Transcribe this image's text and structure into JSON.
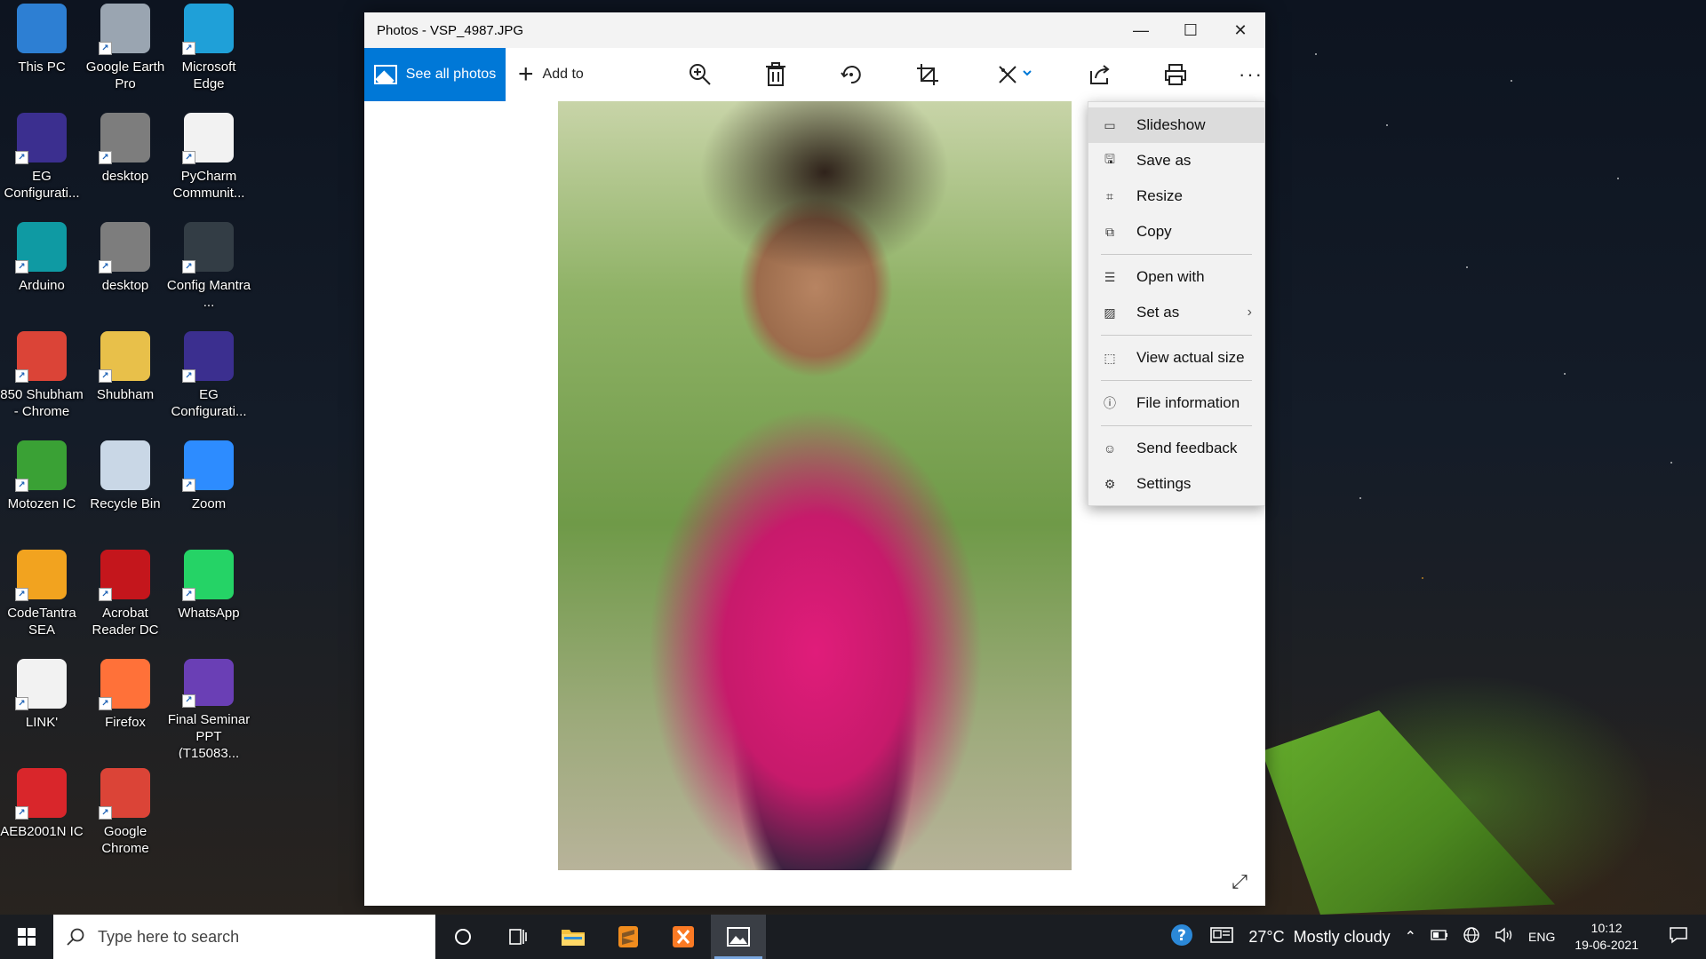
{
  "desktop": {
    "icons": [
      {
        "label": "This PC",
        "icon": "monitor-icon",
        "color": "#2d7fd3"
      },
      {
        "label": "Google Earth Pro",
        "icon": "globe-icon",
        "color": "#9aa5b1"
      },
      {
        "label": "Microsoft Edge",
        "icon": "edge-icon",
        "color": "#1fa0d8"
      },
      {
        "label": "EG Configurati...",
        "icon": "eg-icon",
        "color": "#3b2f8f"
      },
      {
        "label": "desktop",
        "icon": "settings-file-icon",
        "color": "#7d7d7d"
      },
      {
        "label": "PyCharm Communit...",
        "icon": "file-icon",
        "color": "#f2f2f2"
      },
      {
        "label": "Arduino",
        "icon": "arduino-icon",
        "color": "#0f9aa3"
      },
      {
        "label": "desktop",
        "icon": "settings-file-icon",
        "color": "#7d7d7d"
      },
      {
        "label": "Config Mantra ...",
        "icon": "config-icon",
        "color": "#333d45"
      },
      {
        "label": "850 Shubham - Chrome",
        "icon": "chrome-icon",
        "color": "#db4437"
      },
      {
        "label": "Shubham",
        "icon": "user-folder-icon",
        "color": "#e8c04a"
      },
      {
        "label": "EG Configurati...",
        "icon": "eg-icon",
        "color": "#3b2f8f"
      },
      {
        "label": "Motozen IC",
        "icon": "motozen-icon",
        "color": "#3aa135"
      },
      {
        "label": "Recycle Bin",
        "icon": "recycle-bin-icon",
        "color": "#c9d7e6"
      },
      {
        "label": "Zoom",
        "icon": "zoom-icon",
        "color": "#2d8cff"
      },
      {
        "label": "CodeTantra SEA",
        "icon": "sun-icon",
        "color": "#f2a31f"
      },
      {
        "label": "Acrobat Reader DC",
        "icon": "acrobat-icon",
        "color": "#c4161c"
      },
      {
        "label": "WhatsApp",
        "icon": "whatsapp-icon",
        "color": "#25d366"
      },
      {
        "label": "LINK'",
        "icon": "file-icon",
        "color": "#f2f2f2"
      },
      {
        "label": "Firefox",
        "icon": "firefox-icon",
        "color": "#ff7139"
      },
      {
        "label": "Final Seminar PPT (T15083...",
        "icon": "ppt-icon",
        "color": "#6a3fb5"
      },
      {
        "label": "AEB2001N IC",
        "icon": "aeb-icon",
        "color": "#d9262b"
      },
      {
        "label": "Google Chrome",
        "icon": "chrome-icon",
        "color": "#db4437"
      }
    ]
  },
  "window": {
    "title": "Photos - VSP_4987.JPG",
    "toolbar": {
      "see_all": "See all photos",
      "add_to": "Add to"
    }
  },
  "menu": {
    "items": [
      {
        "label": "Slideshow",
        "icon": "slideshow-icon",
        "glyph": "▭"
      },
      {
        "label": "Save as",
        "icon": "save-icon",
        "glyph": "🖫"
      },
      {
        "label": "Resize",
        "icon": "resize-icon",
        "glyph": "⌗"
      },
      {
        "label": "Copy",
        "icon": "copy-icon",
        "glyph": "⧉"
      },
      {
        "label": "Open with",
        "icon": "open-with-icon",
        "glyph": "☰"
      },
      {
        "label": "Set as",
        "icon": "set-as-icon",
        "glyph": "▨"
      },
      {
        "label": "View actual size",
        "icon": "actual-size-icon",
        "glyph": "⬚"
      },
      {
        "label": "File information",
        "icon": "info-icon",
        "glyph": "ⓘ"
      },
      {
        "label": "Send feedback",
        "icon": "feedback-icon",
        "glyph": "☺"
      },
      {
        "label": "Settings",
        "icon": "settings-icon",
        "glyph": "⚙"
      }
    ]
  },
  "taskbar": {
    "search_placeholder": "Type here to search",
    "weather": "27°C  Mostly cloudy",
    "language": "ENG",
    "time": "10:12",
    "date": "19-06-2021"
  }
}
